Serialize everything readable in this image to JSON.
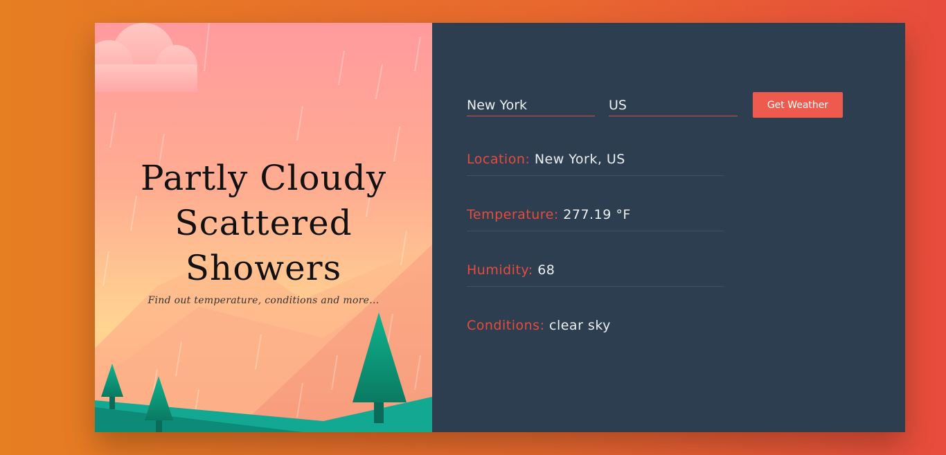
{
  "hero": {
    "headline_lines": [
      "Partly Cloudy",
      "Scattered",
      "Showers"
    ],
    "tagline": "Find out temperature, conditions and more..."
  },
  "form": {
    "city_value": "New York",
    "country_value": "US",
    "submit_label": "Get Weather"
  },
  "results": [
    {
      "label": "Location:",
      "value": "New York, US"
    },
    {
      "label": "Temperature:",
      "value": "277.19 °F"
    },
    {
      "label": "Humidity:",
      "value": "68"
    },
    {
      "label": "Conditions:",
      "value": "clear sky"
    }
  ],
  "colors": {
    "accent": "#e74c3c",
    "panel_dark": "#2c3e50",
    "text_light": "#ecf0f1",
    "tree_green": "#0f9b7f"
  }
}
